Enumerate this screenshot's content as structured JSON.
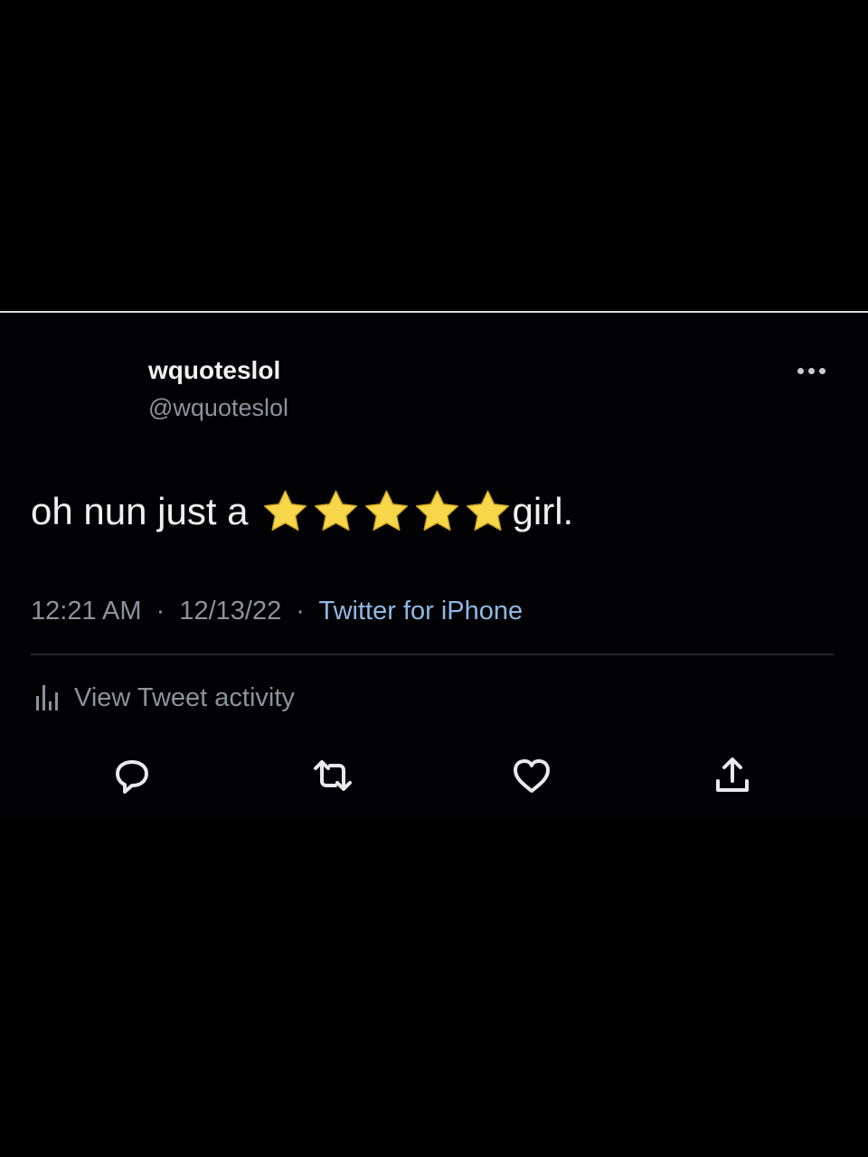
{
  "tweet": {
    "display_name": "wquoteslol",
    "handle": "@wquoteslol",
    "text_before": "oh nun just a",
    "star_count": 5,
    "text_after": "girl.",
    "time": "12:21 AM",
    "date": "12/13/22",
    "source": "Twitter for iPhone",
    "separator": "·"
  },
  "activity": {
    "label": "View Tweet activity"
  },
  "icons": {
    "more": "more-icon",
    "stats": "bar-chart-icon",
    "reply": "reply-icon",
    "retweet": "retweet-icon",
    "like": "heart-icon",
    "share": "share-icon",
    "star": "star-icon"
  },
  "colors": {
    "background": "#000000",
    "text_primary": "#f0f0f0",
    "text_secondary": "#8b9399",
    "link": "#8fb8e3",
    "star_fill": "#f7d64a",
    "divider": "#26292c"
  }
}
